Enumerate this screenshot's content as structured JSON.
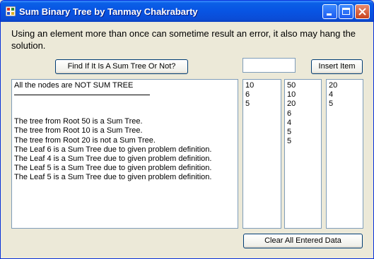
{
  "window": {
    "title": "Sum Binary Tree by Tanmay Chakrabarty",
    "app_icon": "app-icon"
  },
  "info": {
    "text": "Using an element more than once can sometime result an error, it also may  hang the solution."
  },
  "buttons": {
    "find": "Find If It Is A Sum Tree Or Not?",
    "insert": "Insert Item",
    "clear": "Clear All Entered Data"
  },
  "input": {
    "value": ""
  },
  "result": {
    "heading": "All the nodes are NOT SUM TREE",
    "lines": [
      "The tree from Root 50 is a Sum Tree.",
      "The tree from Root 10 is a Sum Tree.",
      "The tree from Root 20 is not a Sum Tree.",
      "The Leaf 6 is a Sum Tree due to given problem definition.",
      "The Leaf 4 is a Sum Tree due to given problem definition.",
      "The Leaf 5 is a Sum Tree due to given problem definition.",
      "The Leaf 5 is a Sum Tree due to given problem definition."
    ]
  },
  "lists": {
    "first": [
      "10",
      "6",
      "5"
    ],
    "second": [
      "50",
      "10",
      "20",
      "6",
      "4",
      "5",
      "5"
    ],
    "third": [
      "20",
      "4",
      "5"
    ]
  },
  "colors": {
    "titlebar": "#0854E3",
    "face": "#ECE9D8",
    "border": "#7F9DB9"
  }
}
